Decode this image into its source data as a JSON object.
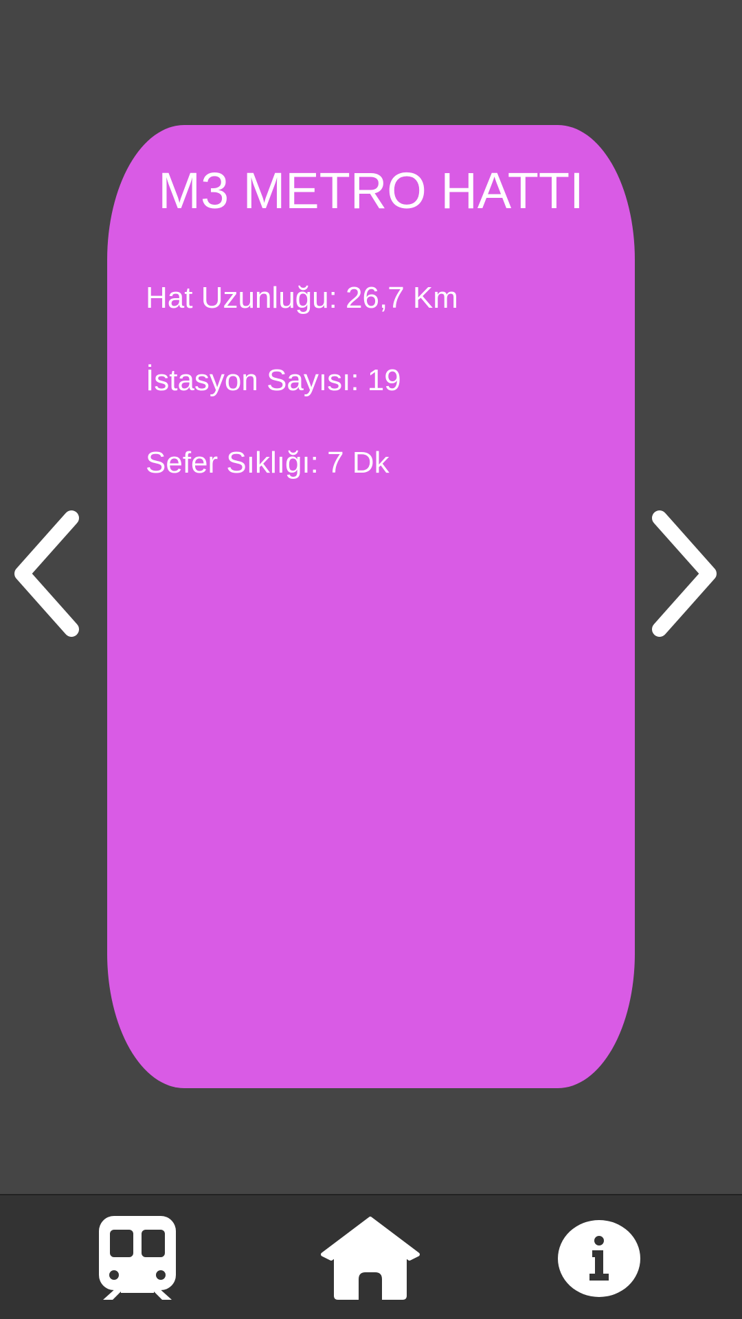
{
  "card": {
    "title": "M3 METRO HATTI",
    "line_length": "Hat Uzunluğu: 26,7 Km",
    "station_count": "İstasyon Sayısı: 19",
    "frequency": "Sefer Sıklığı: 7 Dk",
    "color": "#d95be5"
  },
  "navigation": {
    "prev_icon": "chevron-left-icon",
    "next_icon": "chevron-right-icon"
  },
  "bottom_nav": {
    "items": [
      {
        "icon": "metro-train-icon"
      },
      {
        "icon": "home-icon"
      },
      {
        "icon": "info-icon"
      }
    ],
    "background": "#333333"
  },
  "colors": {
    "background": "#454545",
    "text": "#ffffff"
  }
}
